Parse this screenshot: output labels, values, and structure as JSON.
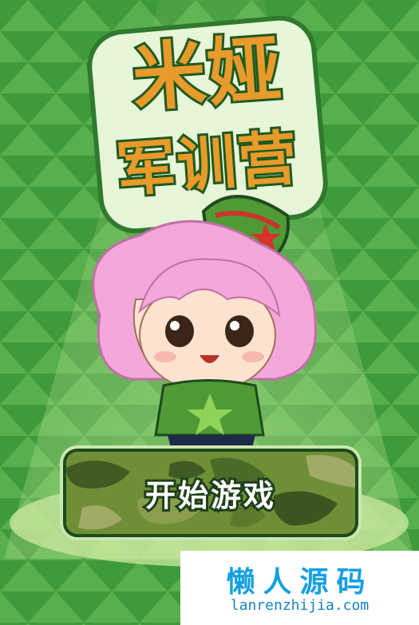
{
  "game": {
    "title_line1": "米娅",
    "title_line2": "军训营",
    "start_label": "开始游戏"
  },
  "watermark": {
    "chinese": "懒人源码",
    "url": "lanrenzhijia.com"
  },
  "colors": {
    "background": "#3f9a3b",
    "triangle_light": "#57b04d",
    "title_fill": "#e89a2a",
    "title_outline": "#1f5a1f",
    "button_camo": "#5a7f2d",
    "hair": "#f4a8da",
    "shirt": "#4f9a35",
    "watermark_text": "#14a0e0"
  }
}
